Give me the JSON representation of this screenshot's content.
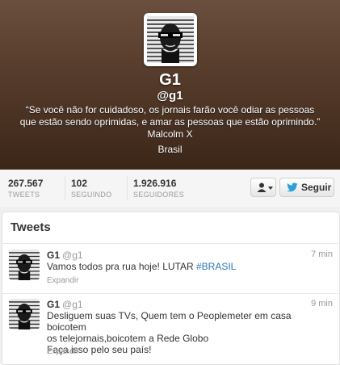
{
  "profile": {
    "name": "G1",
    "handle": "@g1",
    "bio_line1": "“Se você não for cuidadoso, os jornais farão você odiar as pessoas",
    "bio_line2": "que estão sendo oprimidas, e amar as pessoas que estão oprimindo.”",
    "bio_author": "Malcolm X",
    "location": "Brasil"
  },
  "stats": {
    "tweets": {
      "value": "267.567",
      "label": "TWEETS"
    },
    "following": {
      "value": "102",
      "label": "SEGUINDO"
    },
    "followers": {
      "value": "1.926.916",
      "label": "SEGUIDORES"
    }
  },
  "actions": {
    "user_menu_icon": "user-icon",
    "follow_label": "Seguir",
    "follow_icon": "bird-icon"
  },
  "tweets_section": {
    "title": "Tweets",
    "items": [
      {
        "name": "G1",
        "handle": "@g1",
        "time": "7 min",
        "text": "Vamos todos pra rua hoje! LUTAR ",
        "hashtag": "#BRASIL",
        "expand": "Expandir"
      },
      {
        "name": "G1",
        "handle": "@g1",
        "time": "9 min",
        "line1": "Desliguem suas TVs, Quem tem o Peoplemeter em casa boicotem",
        "line2": "os telejornais,boicotem a Rede Globo",
        "line3": "Faça isso pelo seu país!",
        "expand": "Expandir"
      }
    ]
  },
  "colors": {
    "header_dark": "#3b2618",
    "header_light": "#6a4f3f",
    "link": "#2a7ab5",
    "muted": "#999999"
  }
}
